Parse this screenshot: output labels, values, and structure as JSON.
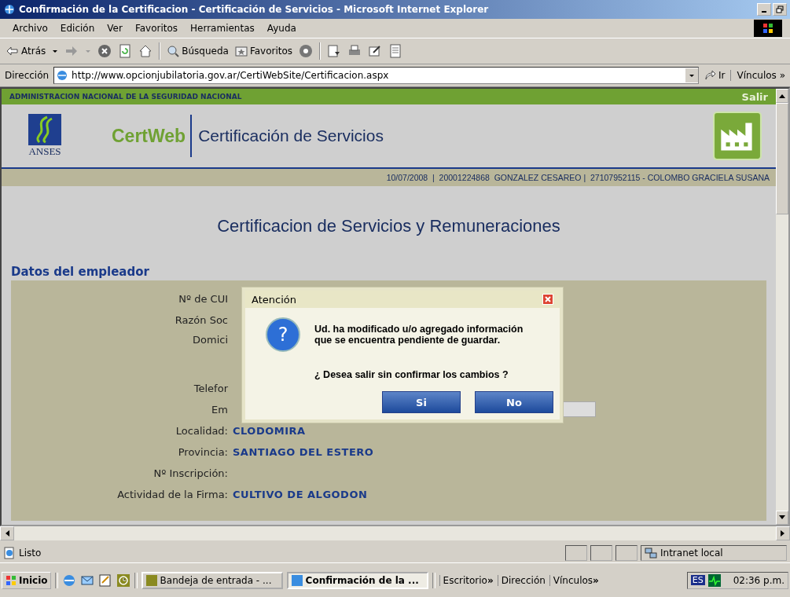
{
  "window": {
    "title": "Confirmación de la Certificacion - Certificación de Servicios - Microsoft Internet Explorer"
  },
  "menu": [
    "Archivo",
    "Edición",
    "Ver",
    "Favoritos",
    "Herramientas",
    "Ayuda"
  ],
  "toolbar": {
    "back": "Atrás",
    "search": "Búsqueda",
    "favorites": "Favoritos"
  },
  "address": {
    "label": "Dirección",
    "url": "http://www.opcionjubilatoria.gov.ar/CertiWebSite/Certificacion.aspx",
    "go": "Ir",
    "links": "Vínculos",
    "more": "»"
  },
  "page": {
    "agency_bar": "ADMINISTRACION NACIONAL DE LA SEGURIDAD NACIONAL",
    "exit": "Salir",
    "logo_text": "ANSES",
    "brand": "CertWeb",
    "app_title": "Certificación de Servicios",
    "info": "10/07/2008  |  20001224868  GONZALEZ CESAREO |  27107952115 - COLOMBO GRACIELA SUSANA",
    "heading": "Certificacion de Servicios y Remuneraciones",
    "section": "Datos del empleador",
    "fields": [
      {
        "label": "Nº de CUI",
        "kind": "text"
      },
      {
        "label": "Razón Soc",
        "kind": "text"
      },
      {
        "label": "Domici",
        "kind": "tall"
      },
      {
        "label": "Telefor",
        "kind": "text"
      },
      {
        "label": "Em",
        "kind": "input"
      },
      {
        "label": "Localidad:",
        "kind": "text",
        "value": "CLODOMIRA"
      },
      {
        "label": "Provincia:",
        "kind": "text",
        "value": "SANTIAGO DEL ESTERO"
      },
      {
        "label": "Nº Inscripción:",
        "kind": "text"
      },
      {
        "label": "Actividad de la Firma:",
        "kind": "text",
        "value": "CULTIVO DE ALGODON"
      }
    ]
  },
  "dialog": {
    "title": "Atención",
    "icon": "?",
    "message": [
      "Ud. ha modificado u/o agregado información",
      "que se encuentra pendiente de guardar."
    ],
    "question": "¿ Desea salir sin confirmar los cambios ?",
    "buttons": [
      "Si",
      "No"
    ]
  },
  "status": {
    "text": "Listo",
    "zone": "Intranet local"
  },
  "taskbar": {
    "start": "Inicio",
    "tasks": [
      {
        "label": "Bandeja de entrada - ...",
        "selected": false
      },
      {
        "label": "Confirmación de la ...",
        "selected": true
      }
    ],
    "toolbars": [
      {
        "label": "Escritorio",
        "more": "»"
      },
      {
        "label": "Dirección"
      },
      {
        "label": "Vínculos",
        "more": "»"
      }
    ],
    "lang": "ES",
    "clock": "02:36 p.m."
  }
}
